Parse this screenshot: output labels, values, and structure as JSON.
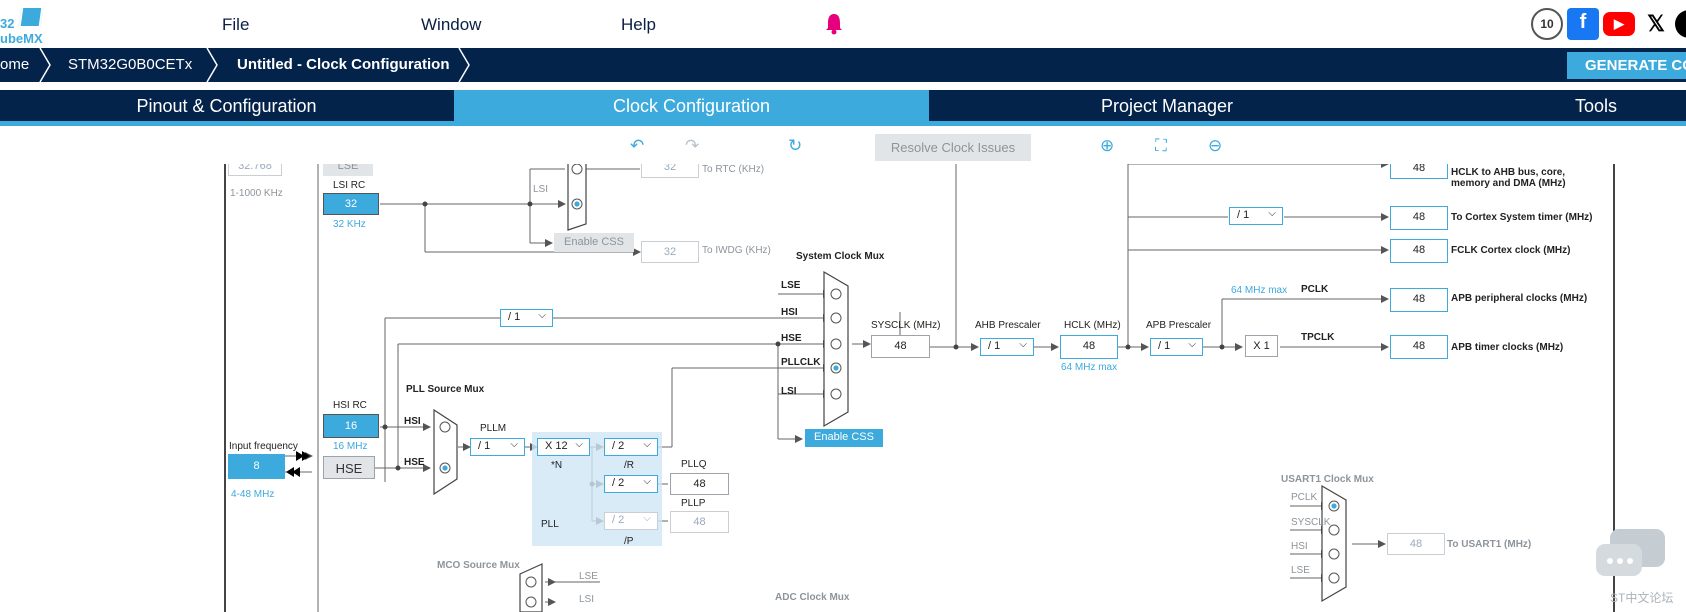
{
  "menu": {
    "file": "File",
    "window": "Window",
    "help": "Help",
    "logo_top": "32",
    "logo_bottom": "ubeMX"
  },
  "social": {
    "x": "𝕏",
    "ten": "10"
  },
  "breadcrumb": {
    "home": "ome",
    "device": "STM32G0B0CETx",
    "page": "Untitled - Clock Configuration"
  },
  "generate_label": "GENERATE CO",
  "tabs": {
    "pinout": "Pinout & Configuration",
    "clock": "Clock Configuration",
    "project": "Project Manager",
    "tools": "Tools"
  },
  "toolbar": {
    "resolve": "Resolve Clock Issues"
  },
  "colors": {
    "accent": "#3caadc",
    "navy": "#03234b",
    "bell": "#e6007e"
  },
  "diagram": {
    "lse_value": "32.768",
    "lse_label": "LSE",
    "lse_range": "1-1000 KHz",
    "lsi_rc_label": "LSI RC",
    "lsi_value": "32",
    "lsi_khz": "32 KHz",
    "rtc_value": "32",
    "rtc_label": "To RTC (KHz)",
    "lsi_mux_label": "LSI",
    "enable_css_1": "Enable CSS",
    "iwdg_value": "32",
    "iwdg_label": "To IWDG (KHz)",
    "sysclk_mux_title": "System Clock Mux",
    "mux_lse": "LSE",
    "mux_hsi": "HSI",
    "mux_hse": "HSE",
    "mux_pllclk": "PLLCLK",
    "mux_lsi": "LSI",
    "hsi_div": "/ 1",
    "hsi_rc_label": "HSI RC",
    "hsi_value": "16",
    "hsi_mhz": "16 MHz",
    "input_freq_label": "Input frequency",
    "input_freq_value": "8",
    "input_range": "4-48 MHz",
    "hse_box": "HSE",
    "pll_source_title": "PLL Source Mux",
    "pll_hsi": "HSI",
    "pll_hse": "HSE",
    "pllm_label": "PLLM",
    "pllm_value": "/ 1",
    "pll_n_value": "X 12",
    "n_label": "*N",
    "pll_r_value": "/ 2",
    "r_label": "/R",
    "pll_q_value": "/ 2",
    "pllq_label": "PLLQ",
    "pllq_out": "48",
    "pll_p_value": "/ 2",
    "pllp_label": "PLLP",
    "pllp_out": "48",
    "p_label": "/P",
    "pll_label": "PLL",
    "enable_css_2": "Enable CSS",
    "sysclk_label": "SYSCLK (MHz)",
    "sysclk_value": "48",
    "ahb_label": "AHB Prescaler",
    "ahb_value": "/ 1",
    "hclk_label": "HCLK (MHz)",
    "hclk_value": "48",
    "hclk_max": "64 MHz max",
    "apb_label": "APB Prescaler",
    "apb_value": "/ 1",
    "x1_value": "X 1",
    "pclk_max": "64 MHz max",
    "pclk_label": "PCLK",
    "tpclk_label": "TPCLK",
    "cortex_div": "/ 1",
    "out_hclk_value": "48",
    "out_hclk_label": "HCLK to AHB bus, core, memory and DMA (MHz)",
    "out_cortex_value": "48",
    "out_cortex_label": "To Cortex System timer (MHz)",
    "out_fclk_value": "48",
    "out_fclk_label": "FCLK Cortex clock (MHz)",
    "out_apb_value": "48",
    "out_apb_label": "APB peripheral clocks (MHz)",
    "out_tim_value": "48",
    "out_tim_label": "APB timer clocks (MHz)",
    "usart_title": "USART1 Clock Mux",
    "usart_pclk": "PCLK",
    "usart_sysclk": "SYSCLK",
    "usart_hsi": "HSI",
    "usart_lse": "LSE",
    "usart_value": "48",
    "usart_label": "To USART1 (MHz)",
    "mco_title": "MCO Source Mux",
    "mco_lse": "LSE",
    "mco_lsi": "LSI",
    "adc_title": "ADC Clock Mux",
    "forum": "ST中文论坛"
  }
}
